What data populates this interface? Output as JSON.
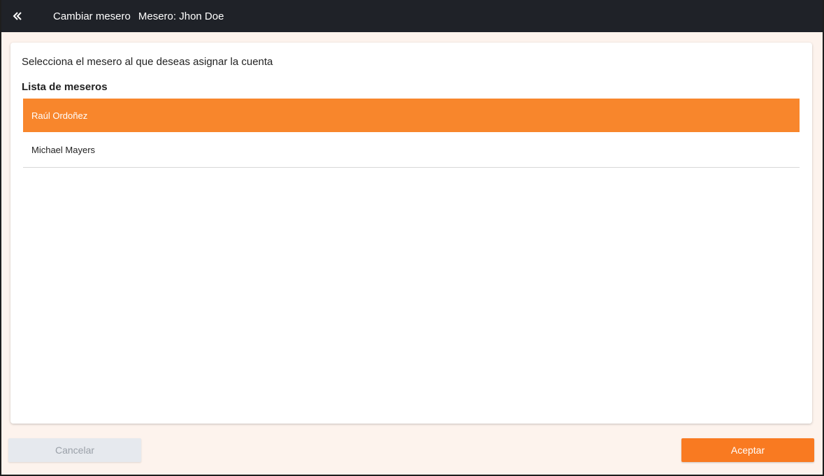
{
  "header": {
    "back_icon": "double-chevron-left-icon",
    "title": "Cambiar mesero",
    "current_waiter": "Mesero: Jhon Doe"
  },
  "main": {
    "instruction": "Selecciona el mesero al que deseas asignar la cuenta",
    "list_heading": "Lista de meseros",
    "waiters": [
      {
        "name": "Raúl Ordoñez",
        "selected": true
      },
      {
        "name": "Michael Mayers",
        "selected": false
      }
    ]
  },
  "footer": {
    "cancel_label": "Cancelar",
    "accept_label": "Aceptar"
  },
  "colors": {
    "accent": "#f97a21",
    "selected_row": "#f8862c",
    "topbar": "#1f2228",
    "background": "#fdf3ed"
  }
}
